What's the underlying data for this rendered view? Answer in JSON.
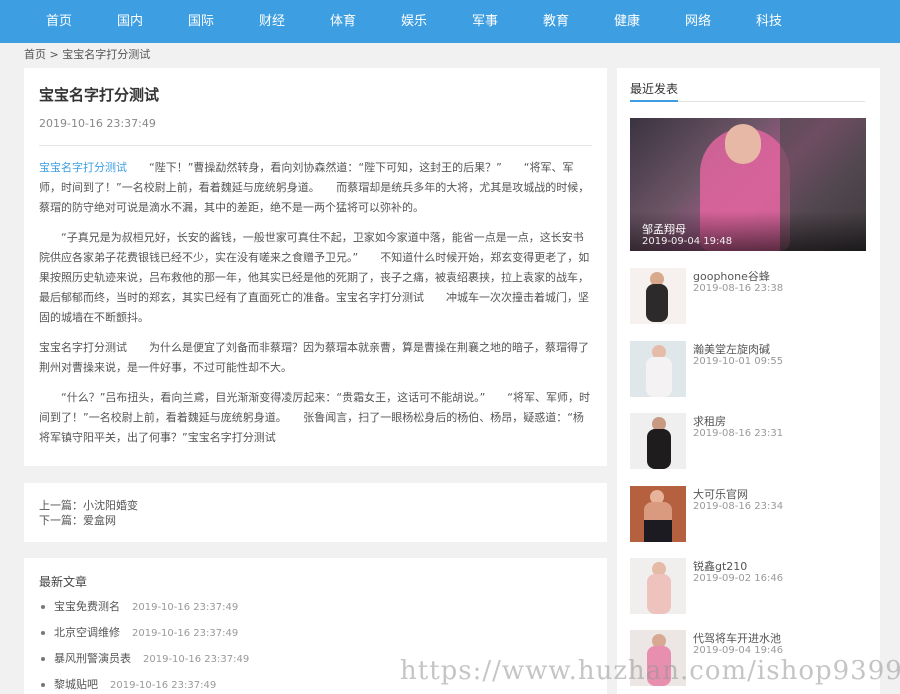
{
  "nav": {
    "items": [
      {
        "label": "首页"
      },
      {
        "label": "国内"
      },
      {
        "label": "国际"
      },
      {
        "label": "财经"
      },
      {
        "label": "体育"
      },
      {
        "label": "娱乐"
      },
      {
        "label": "军事"
      },
      {
        "label": "教育"
      },
      {
        "label": "健康"
      },
      {
        "label": "网络"
      },
      {
        "label": "科技"
      }
    ]
  },
  "breadcrumb": {
    "home": "首页",
    "sep": ">",
    "current": "宝宝名字打分测试"
  },
  "article": {
    "title": "宝宝名字打分测试",
    "date": "2019-10-16 23:37:49",
    "p1_kw": "宝宝名字打分测试",
    "p1": "　　“陛下！”曹操勐然转身，看向刘协森然道：“陛下可知，这封王的后果？”　　“将军、军师，时间到了！”一名校尉上前，看着魏延与庞统躬身道。　　而蔡瑁却是统兵多年的大将，尤其是攻城战的时候，蔡瑁的防守绝对可说是滴水不漏，其中的差距，绝不是一两个猛将可以弥补的。",
    "p2": "　　“子真兄是为叔桓兄好，长安的酱钱，一般世家可真住不起，卫家如今家道中落，能省一点是一点，这长安书院供应各家弟子花费银钱已经不少，实在没有嗟来之食赠予卫兄。”　　不知道什么时候开始，郑玄变得更老了，如果按照历史轨迹来说，吕布救他的那一年，他其实已经是他的死期了，丧子之痛，被袁绍裹挟，拉上袁家的战车，最后郁郁而终，当时的郑玄，其实已经有了直面死亡的准备。宝宝名字打分测试　　冲城车一次次撞击着城门，坚固的城墙在不断颤抖。",
    "p3": "宝宝名字打分测试　　为什么是便宜了刘备而非蔡瑁？因为蔡瑁本就亲曹，算是曹操在荆襄之地的暗子，蔡瑁得了荆州对曹操来说，是一件好事，不过可能性却不大。",
    "p4": "　　“什么？”吕布扭头，看向兰鳶，目光渐渐变得凌厉起来：“贵霜女王，这话可不能胡说。”　　“将军、军师，时间到了！”一名校尉上前，看着魏延与庞统躬身道。　　张鲁闻言，扫了一眼杨松身后的杨伯、杨昂，疑惑道：“杨将军镇守阳平关，出了何事？”宝宝名字打分测试"
  },
  "prevnext": {
    "prev_label": "上一篇：",
    "prev_title": "小沈阳婚变",
    "next_label": "下一篇：",
    "next_title": "爱盒网"
  },
  "latest": {
    "heading": "最新文章",
    "items": [
      {
        "title": "宝宝免费测名",
        "date": "2019-10-16 23:37:49"
      },
      {
        "title": "北京空调维修",
        "date": "2019-10-16 23:37:49"
      },
      {
        "title": "暴风刑警演员表",
        "date": "2019-10-16 23:37:49"
      },
      {
        "title": "黎城贴吧",
        "date": "2019-10-16 23:37:49"
      }
    ]
  },
  "sidebar": {
    "heading": "最近发表",
    "featured": {
      "title": "邹孟翔母",
      "date": "2019-09-04 19:48"
    },
    "items": [
      {
        "title": "goophone谷蜂",
        "date": "2019-08-16 23:38"
      },
      {
        "title": "瀚美堂左旋肉碱",
        "date": "2019-10-01 09:55"
      },
      {
        "title": "求租房",
        "date": "2019-08-16 23:31"
      },
      {
        "title": "大可乐官网",
        "date": "2019-08-16 23:34"
      },
      {
        "title": "锐鑫gt210",
        "date": "2019-09-02 16:46"
      },
      {
        "title": "代驾将车开进水池",
        "date": "2019-09-04 19:46"
      }
    ]
  },
  "watermark": "https://www.huzhan.com/ishop9399",
  "colors": {
    "accent": "#3d9ee2",
    "background": "#f1f1f1"
  }
}
